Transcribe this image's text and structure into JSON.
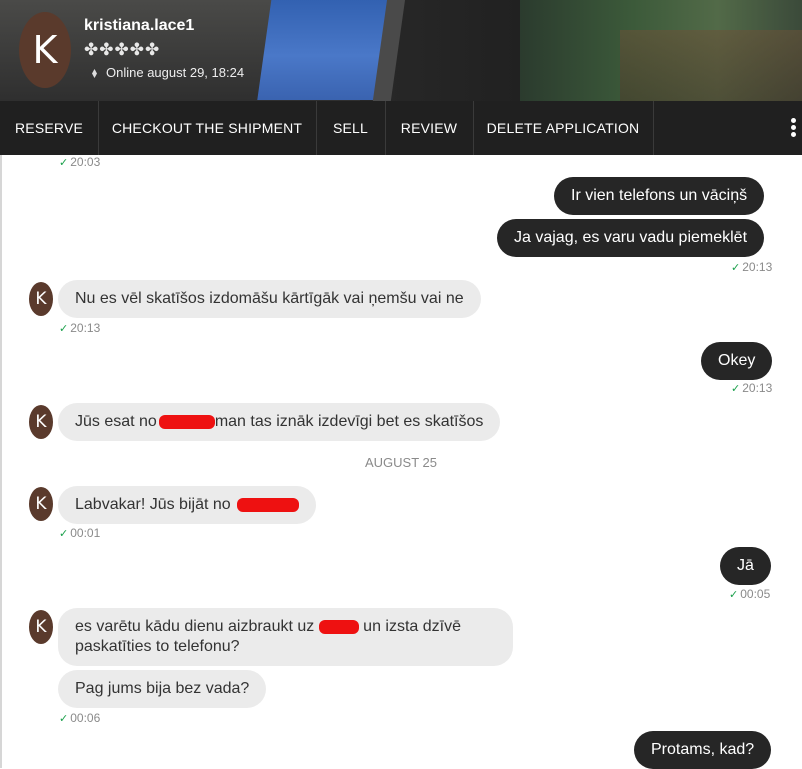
{
  "header": {
    "avatar_letter": "K",
    "username": "kristiana.lace1",
    "rating_stars": "✤✤✤✤✤",
    "online_status": "Online august 29, 18:24"
  },
  "toolbar": {
    "tabs": [
      "RESERVE",
      "CHECKOUT THE SHIPMENT",
      "SELL",
      "REVIEW",
      "DELETE APPLICATION"
    ]
  },
  "chat": {
    "avatar_letter": "K",
    "date_separator": "AUGUST 25",
    "messages": [
      {
        "dir": "in_time_only",
        "time": "20:03"
      },
      {
        "dir": "out",
        "text": "Ir vien telefons un vāciņš"
      },
      {
        "dir": "out",
        "text": "Ja vajag, es varu vadu piemeklēt",
        "time": "20:13"
      },
      {
        "dir": "in",
        "text": "Nu es vēl skatīšos izdomāšu kārtīgāk vai ņemšu vai ne",
        "time": "20:13"
      },
      {
        "dir": "out",
        "text": "Okey",
        "time": "20:13"
      },
      {
        "dir": "in",
        "text_before": "Jūs esat no",
        "text_after": "man tas iznāk izdevīgi bet es skatīšos"
      },
      {
        "dir": "in",
        "text_before": "Labvakar! Jūs bijāt no",
        "time": "00:01"
      },
      {
        "dir": "out",
        "text": "Jā",
        "time": "00:05"
      },
      {
        "dir": "in",
        "text_before": "es varētu kādu dienu aizbraukt uz",
        "text_after": "un izsta dzīvē paskatīties to telefonu?"
      },
      {
        "dir": "in",
        "text": "Pag jums bija bez vada?",
        "time": "00:06"
      },
      {
        "dir": "out",
        "text": "Protams, kad?"
      }
    ]
  },
  "colors": {
    "outgoing_bubble": "#262626",
    "incoming_bubble": "#ebebeb",
    "avatar": "#5a3a2c",
    "read_check": "#1aa04a",
    "toolbar": "#202020",
    "redaction": "#ee1111"
  }
}
